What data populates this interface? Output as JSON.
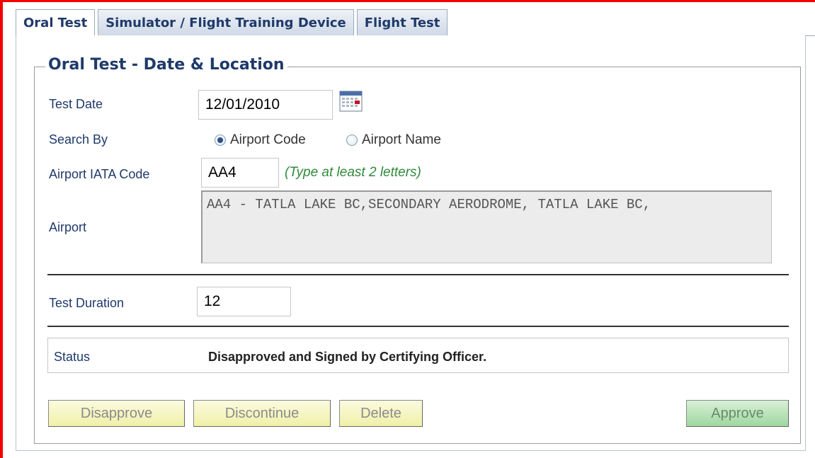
{
  "tabs": [
    {
      "label": "Oral Test",
      "active": true
    },
    {
      "label": "Simulator / Flight Training Device",
      "active": false
    },
    {
      "label": "Flight Test",
      "active": false
    }
  ],
  "section": {
    "legend": "Oral Test - Date & Location"
  },
  "test_date": {
    "label": "Test Date",
    "value": "12/01/2010",
    "icon": "calendar-icon"
  },
  "search_by": {
    "label": "Search By",
    "options": [
      {
        "label": "Airport Code",
        "checked": true
      },
      {
        "label": "Airport Name",
        "checked": false
      }
    ]
  },
  "airport_code": {
    "label": "Airport IATA Code",
    "value": "AA4",
    "hint": "(Type at least 2 letters)"
  },
  "airport": {
    "label": "Airport",
    "value": "AA4 - TATLA LAKE BC,SECONDARY AERODROME, TATLA LAKE BC,"
  },
  "test_duration": {
    "label": "Test Duration",
    "value": "12"
  },
  "status": {
    "label": "Status",
    "value": "Disapproved and Signed by Certifying Officer."
  },
  "buttons": {
    "disapprove": "Disapprove",
    "discontinue": "Discontinue",
    "delete": "Delete",
    "approve": "Approve"
  },
  "colors": {
    "frame": "#f40000",
    "label": "#1f3a6a",
    "hint": "#2f8a3a",
    "button_yellow": "#f0f0a8",
    "button_green": "#9fd79f"
  }
}
